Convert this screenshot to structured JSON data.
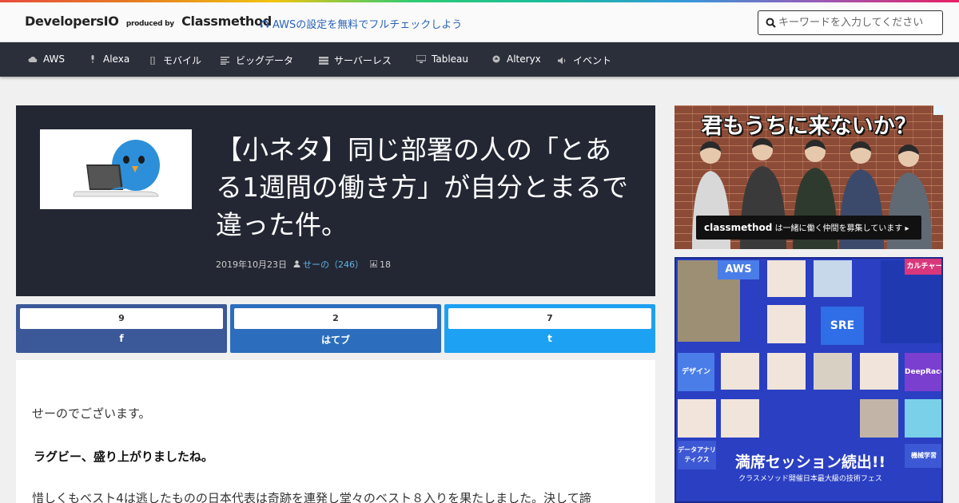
{
  "header": {
    "logo_main": "DevelopersIO",
    "logo_produced": "produced by",
    "logo_company": "Classmethod",
    "promo_link": "AWSの設定を無料でフルチェックしよう",
    "search_placeholder": "キーワードを入力してください"
  },
  "nav": {
    "items": [
      {
        "label": "AWS",
        "icon": "cloud-icon"
      },
      {
        "label": "Alexa",
        "icon": "microphone-icon"
      },
      {
        "label": "モバイル",
        "icon": "mobile-icon"
      },
      {
        "label": "ビッグデータ",
        "icon": "align-left-icon"
      },
      {
        "label": "サーバーレス",
        "icon": "server-icon"
      },
      {
        "label": "Tableau",
        "icon": "desktop-icon"
      },
      {
        "label": "Alteryx",
        "icon": "circle-arrow-icon"
      },
      {
        "label": "イベント",
        "icon": "volume-icon"
      }
    ]
  },
  "article": {
    "title": "【小ネタ】同じ部署の人の「とある1週間の働き方」が自分とまるで違った件。",
    "date": "2019年10月23日",
    "author": "せーの（246）",
    "views": "18",
    "paragraphs": [
      "せーのでございます。",
      "ラグビー、盛り上がりましたね。",
      "惜しくもベスト4は逃したものの日本代表は奇跡を連発し堂々のベスト８入りを果たしました。決して諦"
    ]
  },
  "share": {
    "facebook": {
      "count": "9",
      "label": "f",
      "color": "#3b5998"
    },
    "hatena": {
      "count": "2",
      "label": "はてブ",
      "color": "#2c6ebd"
    },
    "twitter": {
      "count": "7",
      "label": "t",
      "color": "#1da1f2"
    }
  },
  "sidebar": {
    "ad1": {
      "headline": "君もうちに来ないか？",
      "banner_brand": "classmethod",
      "banner_text": "は一緒に働く仲間を募集しています ▸"
    },
    "ad2": {
      "labels": {
        "aws": "AWS",
        "sre": "SRE",
        "culture": "カルチャー",
        "design": "デザイン",
        "deepracer": "DeepRacer",
        "data_analytics": "データアナリティクス",
        "ml": "機械学習"
      },
      "headline": "満席セッション続出!!",
      "subline": "クラスメソッド開催日本最大級の技術フェス"
    }
  }
}
